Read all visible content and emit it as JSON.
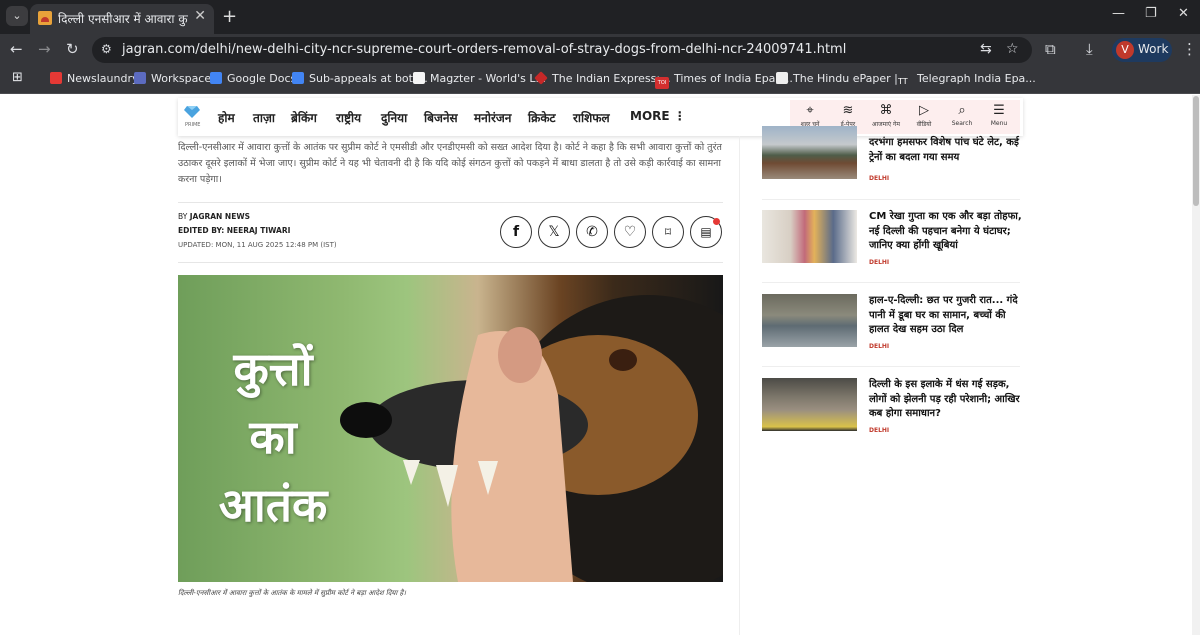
{
  "browser": {
    "tab_title": "दिल्ली एनसीआर में आवारा कुत्तों के",
    "url": "jagran.com/delhi/new-delhi-city-ncr-supreme-court-orders-removal-of-stray-dogs-from-delhi-ncr-24009741.html",
    "profile_initial": "V",
    "profile_name": "Work",
    "bookmarks": [
      {
        "label": "Newslaundry",
        "color": "#e53935"
      },
      {
        "label": "Workspace",
        "color": "#5c6bc0"
      },
      {
        "label": "Google Docs",
        "color": "#4285f4"
      },
      {
        "label": "Sub-appeals at bott...",
        "color": "#4285f4"
      },
      {
        "label": "Magzter - World's L...",
        "color": "#f5f5f5"
      },
      {
        "label": "The Indian Express:...",
        "color": "#c62828"
      },
      {
        "label": "Times of India Epap...",
        "color": "#d32f2f"
      },
      {
        "label": "The Hindu ePaper |...",
        "color": "#eeeeee"
      },
      {
        "label": "Telegraph India Epa...",
        "color": "#222222"
      }
    ],
    "bookmark_badges": {
      "toi": "TOI",
      "telegraph": "TT"
    }
  },
  "site_nav": {
    "logo_label": "PRIME",
    "items": [
      "होम",
      "ताज़ा",
      "ब्रेकिंग",
      "राष्ट्रीय",
      "दुनिया",
      "बिजनेस",
      "मनोरंजन",
      "क्रिकेट",
      "राशिफल",
      "MORE ⋮"
    ],
    "right_items": [
      {
        "label": "शहर चुनें",
        "icon": "location-pin-icon"
      },
      {
        "label": "ई-पेपर",
        "icon": "layers-icon"
      },
      {
        "label": "आजमाएं गेम",
        "icon": "gamepad-icon"
      },
      {
        "label": "वीडियो",
        "icon": "video-icon"
      },
      {
        "label": "Search",
        "icon": "search-icon"
      },
      {
        "label": "Menu",
        "icon": "hamburger-icon"
      }
    ]
  },
  "article": {
    "intro": "दिल्ली-एनसीआर में आवारा कुत्तों के आतंक पर सुप्रीम कोर्ट ने एमसीडी और एनडीएमसी को सख्त आदेश दिया है। कोर्ट ने कहा है कि सभी आवारा कुत्तों को तुरंत उठाकर दूसरे इलाकों में भेजा जाए। सुप्रीम कोर्ट ने यह भी चेतावनी दी है कि यदि कोई संगठन कुत्तों को पकड़ने में बाधा डालता है तो उसे कड़ी कार्रवाई का सामना करना पड़ेगा।",
    "by_prefix": "BY",
    "by_name": "JAGRAN NEWS",
    "edited_prefix": "EDITED BY:",
    "edited_name": "NEERAJ TIWARI",
    "updated": "UPDATED: MON, 11 AUG 2025 12:48 PM (IST)",
    "share_icons": [
      "facebook-icon",
      "x-icon",
      "whatsapp-icon",
      "heart-icon",
      "bookmark-icon",
      "comment-icon"
    ],
    "image_text": [
      "कुत्तों",
      "का",
      "आतंक"
    ],
    "caption": "दिल्ली-एनसीआर में आवारा कुत्तों के आतंक के मामले में सुप्रीम कोर्ट ने बड़ा आदेश दिया है।"
  },
  "sidebar": {
    "stories": [
      {
        "title": "दरभंगा हमसफर विशेष पांच घंटे लेट, कई ट्रेनों का बदला गया समय",
        "tag": "DELHI"
      },
      {
        "title": "CM रेखा गुप्ता का एक और बड़ा तोहफा, नई दिल्ली की पहचान बनेगा ये घंटाघर; जानिए क्या होंगी खूबियां",
        "tag": "DELHI"
      },
      {
        "title": "हाल-ए-दिल्ली: छत पर गुजरी रात... गंदे पानी में डूबा घर का सामान, बच्चों की हालत देख सहम उठा दिल",
        "tag": "DELHI"
      },
      {
        "title": "दिल्ली के इस इलाके में धंस गई सड़क, लोगों को झेलनी पड़ रही परेशानी; आखिर कब होगा समाधान?",
        "tag": "DELHI"
      }
    ]
  }
}
